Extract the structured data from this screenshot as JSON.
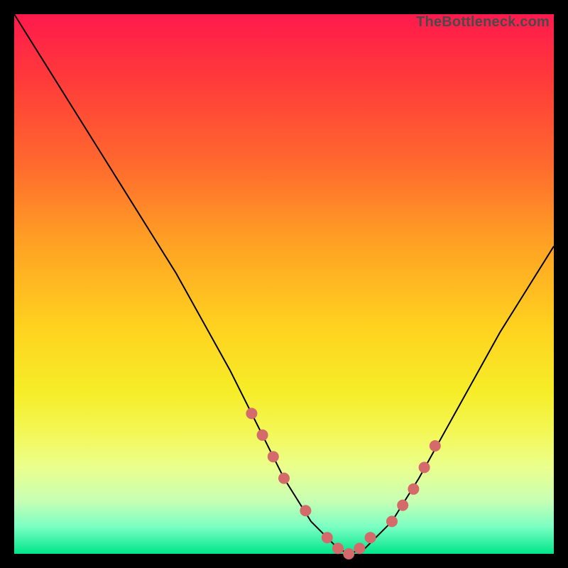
{
  "watermark": "TheBottleneck.com",
  "chart_data": {
    "type": "line",
    "title": "",
    "xlabel": "",
    "ylabel": "",
    "xlim": [
      0,
      100
    ],
    "ylim": [
      0,
      100
    ],
    "grid": false,
    "legend": false,
    "background_gradient": {
      "top_color": "#ff1a4d",
      "mid_color": "#ffd21f",
      "bottom_color": "#00e58a"
    },
    "series": [
      {
        "name": "bottleneck-curve",
        "color": "#000000",
        "x": [
          0,
          5,
          10,
          15,
          20,
          25,
          30,
          35,
          40,
          45,
          50,
          55,
          60,
          62,
          65,
          70,
          75,
          80,
          85,
          90,
          95,
          100
        ],
        "y": [
          100,
          92,
          84,
          76,
          68,
          60,
          52,
          43,
          34,
          24,
          14,
          6,
          1,
          0,
          1,
          6,
          14,
          23,
          32,
          41,
          49,
          57
        ]
      }
    ],
    "highlight_points": {
      "name": "highlighted-range",
      "color": "#d46a6a",
      "x": [
        44,
        46,
        48,
        50,
        54,
        58,
        60,
        62,
        64,
        66,
        70,
        72,
        74,
        76,
        78
      ],
      "y": [
        26,
        22,
        18,
        14,
        8,
        3,
        1,
        0,
        1,
        3,
        6,
        9,
        12,
        16,
        20
      ]
    }
  }
}
